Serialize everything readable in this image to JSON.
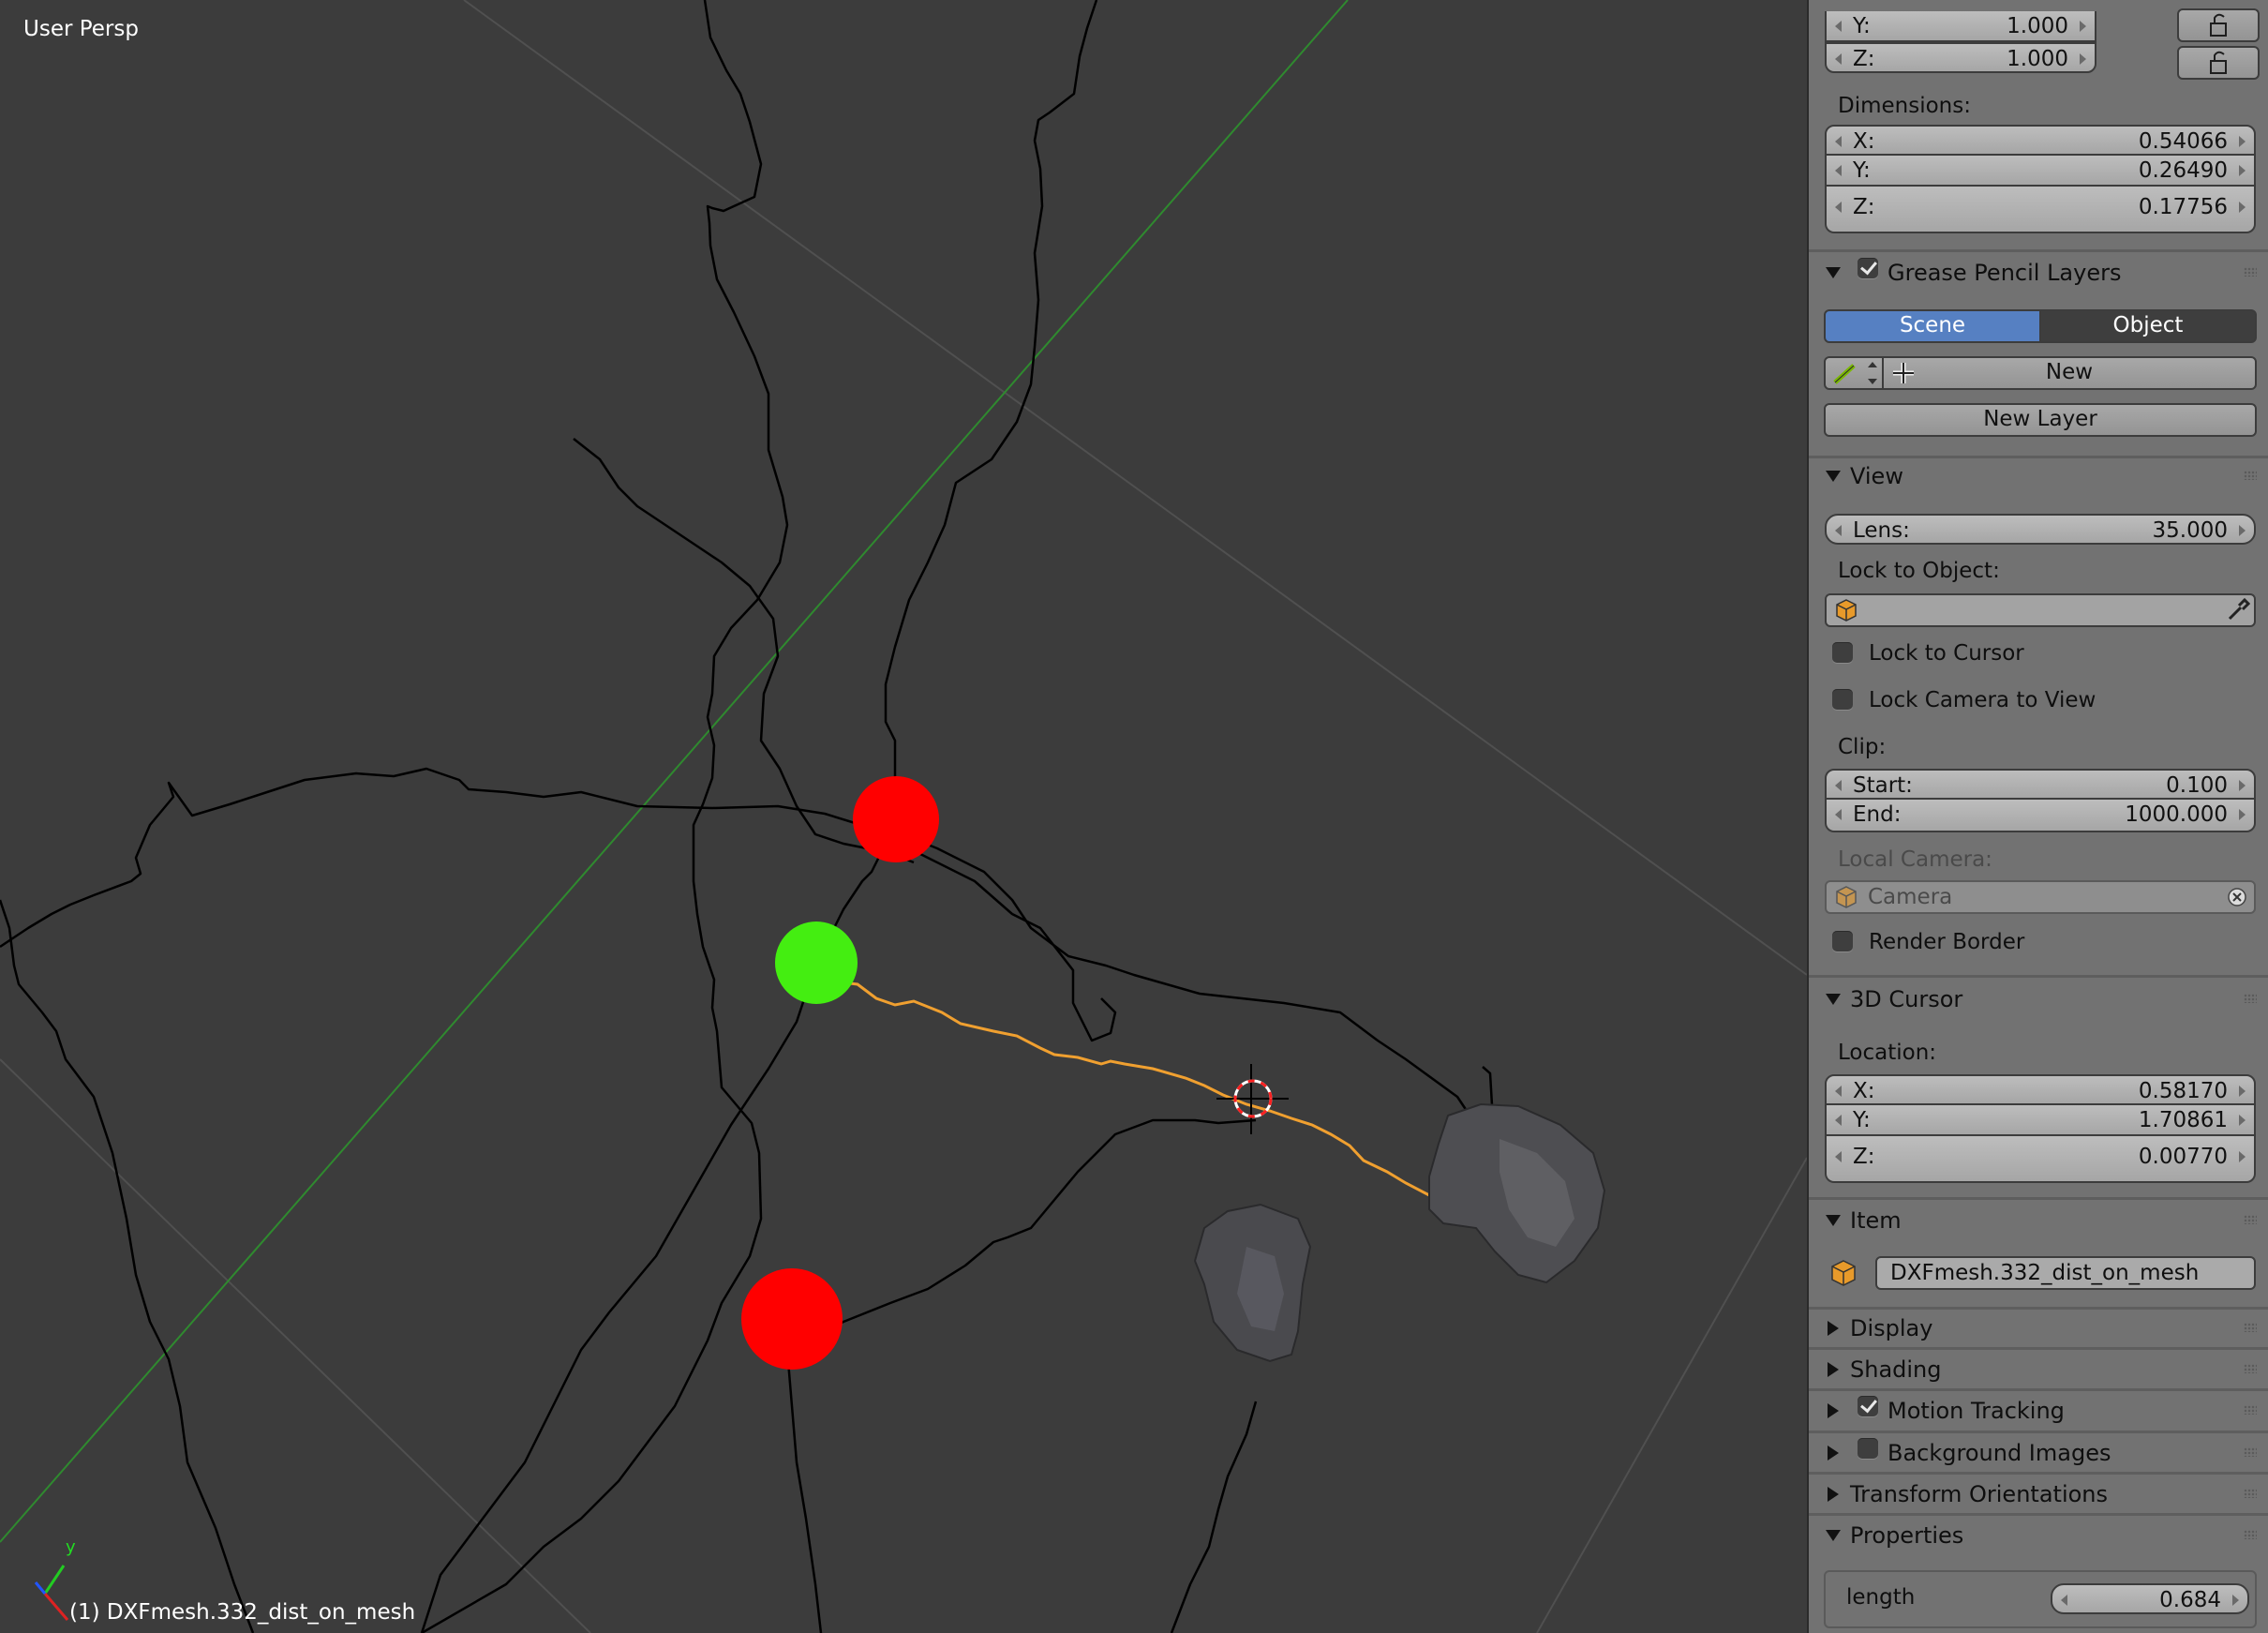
{
  "viewport": {
    "view_label": "User Persp",
    "object_label": "(1) DXFmesh.332_dist_on_mesh",
    "axis_y": "y"
  },
  "scale": {
    "y_label": "Y:",
    "y_value": "1.000",
    "z_label": "Z:",
    "z_value": "1.000"
  },
  "dimensions": {
    "title": "Dimensions:",
    "x_label": "X:",
    "x_value": "0.54066",
    "y_label": "Y:",
    "y_value": "0.26490",
    "z_label": "Z:",
    "z_value": "0.17756"
  },
  "grease_pencil": {
    "title": "Grease Pencil Layers",
    "checked": true,
    "tab_scene": "Scene",
    "tab_object": "Object",
    "new_label": "New",
    "new_layer_label": "New Layer"
  },
  "view": {
    "title": "View",
    "lens_label": "Lens:",
    "lens_value": "35.000",
    "lock_to_object": "Lock to Object:",
    "lock_to_cursor": "Lock to Cursor",
    "lock_camera_to_view": "Lock Camera to View",
    "clip": "Clip:",
    "start_label": "Start:",
    "start_value": "0.100",
    "end_label": "End:",
    "end_value": "1000.000",
    "local_camera": "Local Camera:",
    "camera_value": "Camera",
    "render_border": "Render Border"
  },
  "cursor": {
    "title": "3D Cursor",
    "location": "Location:",
    "x_label": "X:",
    "x_value": "0.58170",
    "y_label": "Y:",
    "y_value": "1.70861",
    "z_label": "Z:",
    "z_value": "0.00770"
  },
  "item": {
    "title": "Item",
    "name": "DXFmesh.332_dist_on_mesh"
  },
  "collapsed_sections": {
    "display": "Display",
    "shading": "Shading",
    "motion_tracking": "Motion Tracking",
    "background_images": "Background Images",
    "transform_orientations": "Transform Orientations"
  },
  "properties": {
    "title": "Properties",
    "length_label": "length",
    "length_value": "0.684"
  },
  "colors": {
    "selected_tab": "#5680c2",
    "marker_red": "#ff0000",
    "marker_green": "#44ee11",
    "path_orange": "#f0a030"
  }
}
